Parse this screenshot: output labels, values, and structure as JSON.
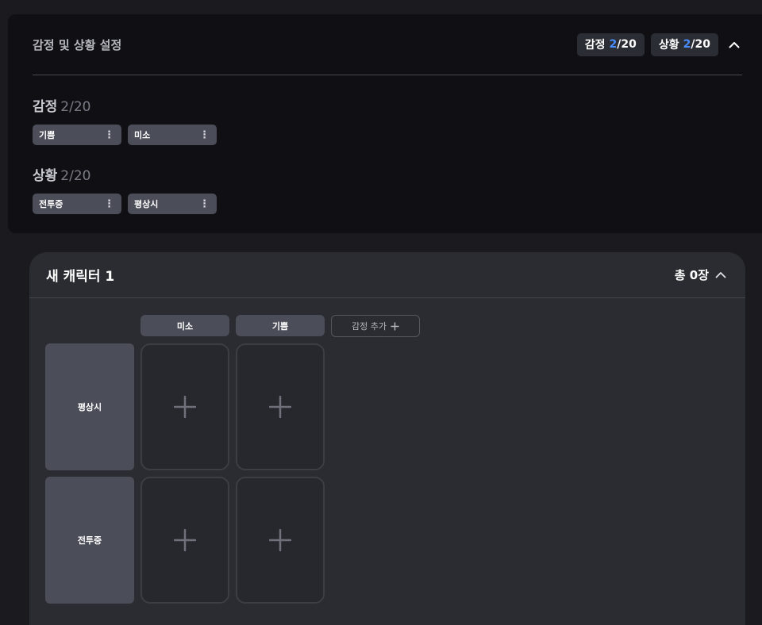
{
  "settings": {
    "title": "감정 및 상황 설정",
    "emotion_badge": {
      "label": "감정",
      "count": "2",
      "total": "/20"
    },
    "situation_badge": {
      "label": "상황",
      "count": "2",
      "total": "/20"
    },
    "emotion_section": {
      "title": "감정",
      "count": "2/20",
      "chips": [
        "기쁨",
        "미소"
      ]
    },
    "situation_section": {
      "title": "상황",
      "count": "2/20",
      "chips": [
        "전투중",
        "평상시"
      ]
    },
    "kebab": "⋮"
  },
  "character": {
    "title": "새 캐릭터 1",
    "total": "총 0장",
    "columns": [
      "미소",
      "기쁨"
    ],
    "add_emotion_label": "감정 추가",
    "rows": [
      "평상시",
      "전투중"
    ]
  },
  "colors": {
    "accent": "#4a8dff"
  }
}
